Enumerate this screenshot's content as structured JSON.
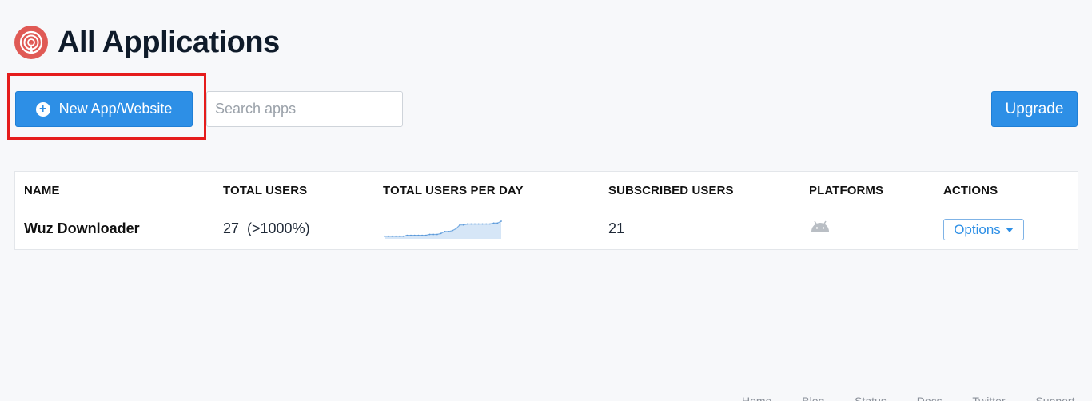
{
  "header": {
    "title": "All Applications",
    "logo_icon": "broadcast-logo-icon"
  },
  "toolbar": {
    "new_button_label": "New App/Website",
    "new_button_icon": "plus-circle-icon",
    "search_placeholder": "Search apps",
    "search_value": "",
    "upgrade_label": "Upgrade"
  },
  "table": {
    "columns": [
      "NAME",
      "TOTAL USERS",
      "TOTAL USERS PER DAY",
      "SUBSCRIBED USERS",
      "PLATFORMS",
      "ACTIONS"
    ],
    "rows": [
      {
        "name": "Wuz Downloader",
        "total_users": "27  (>1000%)",
        "users_per_day": [
          1,
          1,
          1,
          1,
          1,
          1,
          2,
          2,
          2,
          2,
          2,
          2,
          3,
          3,
          3,
          4,
          6,
          6,
          7,
          9,
          13,
          13,
          14,
          14,
          14,
          14,
          14,
          14,
          14,
          15,
          15,
          17
        ],
        "subscribed_users": "21",
        "platforms": [
          "android"
        ],
        "actions_label": "Options"
      }
    ]
  },
  "footer": {
    "links": [
      "Home",
      "Blog",
      "Status",
      "Docs",
      "Twitter",
      "Support"
    ]
  },
  "colors": {
    "primary": "#2d8fe6",
    "logo": "#e05a55",
    "highlight": "#e51c1c"
  }
}
